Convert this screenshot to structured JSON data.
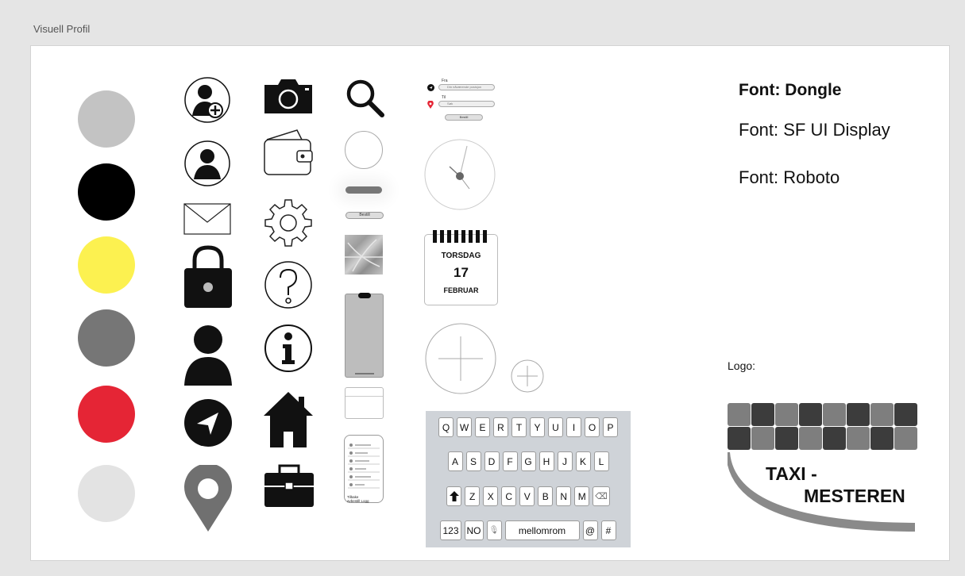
{
  "frame": {
    "title": "Visuell Profil"
  },
  "colors": {
    "palette": [
      "#c3c3c3",
      "#000000",
      "#fcf150",
      "#767676",
      "#e52535",
      "#e3e3e3"
    ]
  },
  "icons": {
    "column1": [
      "add-user-icon",
      "user-circle-icon",
      "mail-icon",
      "lock-icon",
      "user-icon",
      "navigation-icon",
      "location-pin-icon"
    ],
    "column2": [
      "camera-icon",
      "wallet-icon",
      "gear-icon",
      "help-icon",
      "info-icon",
      "home-icon",
      "briefcase-icon"
    ],
    "column3": [
      "search-icon"
    ]
  },
  "route_form": {
    "from_label": "Fra",
    "from_placeholder": "Din nåværende posisjon",
    "to_label": "Til",
    "to_placeholder": "Søk",
    "button_label": "Bestill"
  },
  "calendar": {
    "weekday": "TORSDAG",
    "day": "17",
    "month": "FEBRUAR"
  },
  "small_button": {
    "label": "Bestill"
  },
  "menu_screen": {
    "bottom_text": "Tilbake  avbestill  Logg"
  },
  "keyboard": {
    "row1": [
      "Q",
      "W",
      "E",
      "R",
      "T",
      "Y",
      "U",
      "I",
      "O",
      "P"
    ],
    "row2": [
      "A",
      "S",
      "D",
      "F",
      "G",
      "H",
      "J",
      "K",
      "L"
    ],
    "row3": [
      "Z",
      "X",
      "C",
      "V",
      "B",
      "N",
      "M"
    ],
    "backspace": "⌫",
    "numbers_key": "123",
    "language_key": "NO",
    "mic_key": "🎙",
    "space_key": "mellomrom",
    "at_key": "@",
    "hash_key": "#"
  },
  "fonts": {
    "line1": "Font: Dongle",
    "line2": "Font: SF UI Display",
    "line3": "Font: Roboto"
  },
  "logo": {
    "label": "Logo:",
    "text_top": "TAXI -",
    "text_bottom": "MESTEREN"
  }
}
